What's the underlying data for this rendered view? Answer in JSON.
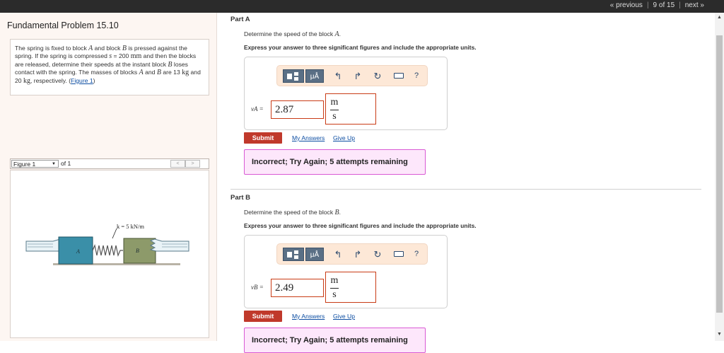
{
  "topnav": {
    "previous": "« previous",
    "position": "9 of 15",
    "next": "next »"
  },
  "left": {
    "title": "Fundamental Problem 15.10",
    "problem": {
      "t1": "The spring is fixed to block ",
      "blockA": "A",
      "t2": " and block ",
      "blockB": "B",
      "t3": " is pressed against the spring. If the spring is compressed ",
      "s": "s",
      "t4": " = 200 ",
      "mm": "mm",
      "t5": " and then the blocks are released, determine their speeds at the instant block ",
      "blockB2": "B",
      "t6": " loses contact with the spring. The masses of blocks ",
      "blockA2": "A",
      "t7": " and ",
      "blockB3": "B",
      "t8": " are 13 ",
      "kg1": "kg",
      "t9": " and 20 ",
      "kg2": "kg",
      "t10": ", respectively. (",
      "figlink": "Figure 1",
      "t11": ")"
    },
    "figure": {
      "select": "Figure 1",
      "of": "of 1",
      "prev": "<",
      "next": ">",
      "spring_label": "k = 5 kN/m",
      "label_a": "A",
      "label_b": "B"
    }
  },
  "partA": {
    "title": "Part A",
    "question_pre": "Determine the speed of the block ",
    "question_var": "A",
    "question_post": ".",
    "instruction": "Express your answer to three significant figures and include the appropriate units.",
    "variable": "vA =",
    "value": "2.87",
    "unit_num": "m",
    "unit_den": "s",
    "submit": "Submit",
    "my_answers": "My Answers",
    "give_up": "Give Up",
    "feedback": "Incorrect; Try Again; 5 attempts remaining"
  },
  "partB": {
    "title": "Part B",
    "question_pre": "Determine the speed of the block ",
    "question_var": "B",
    "question_post": ".",
    "instruction": "Express your answer to three significant figures and include the appropriate units.",
    "variable": "vB =",
    "value": "2.49",
    "unit_num": "m",
    "unit_den": "s",
    "submit": "Submit",
    "my_answers": "My Answers",
    "give_up": "Give Up",
    "feedback": "Incorrect; Try Again; 5 attempts remaining"
  },
  "toolbar": {
    "mu_label": "μÅ",
    "undo": "↰",
    "redo": "↱",
    "reset": "↻",
    "help": "?"
  },
  "colors": {
    "submit": "#c0392b",
    "feedback_bg": "#fde7fb",
    "feedback_border": "#d95ad5",
    "toolbar_bg": "#fde8d7",
    "block": "#3a8fa8",
    "block_b": "#8d9a6a"
  }
}
